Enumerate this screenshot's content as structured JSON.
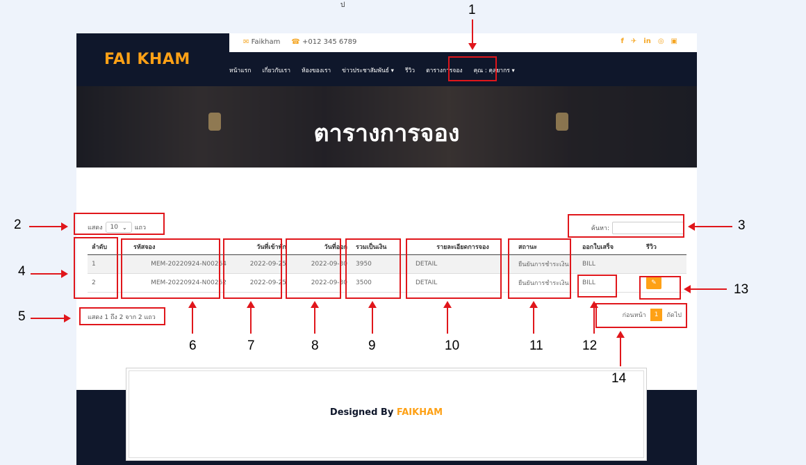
{
  "stray_glyph": "ป",
  "site": {
    "logo": "FAI KHAM",
    "contact_email": "Faikham",
    "contact_phone": "+012 345 6789",
    "social": [
      "f",
      "y",
      "in",
      "ig",
      "yt"
    ],
    "menu": [
      {
        "label": "หน้าแรก"
      },
      {
        "label": "เกี่ยวกับเรา"
      },
      {
        "label": "ห้องของเรา"
      },
      {
        "label": "ข่าวประชาสัมพันธ์ ▾"
      },
      {
        "label": "รีวิว"
      },
      {
        "label": "ตารางการจอง"
      },
      {
        "label": "คุณ : คุลยากร ▾"
      }
    ],
    "hero_title": "ตารางการจอง"
  },
  "table": {
    "show_label": "แสดง",
    "page_size": "10",
    "rows_label": "แถว",
    "search_label": "ค้นหา:",
    "search_value": "",
    "headers": [
      "ลำดับ",
      "รหัสจอง",
      "วันที่เข้าพัก",
      "วันที่ออก",
      "รวมเป็นเงิน",
      "รายละเอียดการจอง",
      "สถานะ",
      "ออกใบเสร็จ",
      "รีวิว"
    ],
    "rows": [
      {
        "no": "1",
        "code": "MEM-20220924-N00264",
        "checkin": "2022-09-25",
        "checkout": "2022-09-30",
        "total": "3950",
        "detail": "DETAIL",
        "status": "ยืนยันการชำระเงิน",
        "bill": "BILL"
      },
      {
        "no": "2",
        "code": "MEM-20220924-N00262",
        "checkin": "2022-09-25",
        "checkout": "2022-09-30",
        "total": "3500",
        "detail": "DETAIL",
        "status": "ยืนยันการชำระเงิน",
        "bill": "BILL"
      }
    ],
    "info": "แสดง 1 ถึง 2 จาก 2 แถว",
    "pager": {
      "prev": "ก่อนหน้า",
      "current": "1",
      "next": "ถัดไป"
    }
  },
  "footer": {
    "designed_by": "Designed By",
    "brand": "FAIKHAM"
  },
  "annotations": [
    "1",
    "2",
    "3",
    "4",
    "5",
    "6",
    "7",
    "8",
    "9",
    "10",
    "11",
    "12",
    "13",
    "14"
  ],
  "colors": {
    "accent": "#fea116",
    "navy": "#0f172b",
    "annotation": "#e0161b",
    "status_green": "#2e7d32"
  }
}
